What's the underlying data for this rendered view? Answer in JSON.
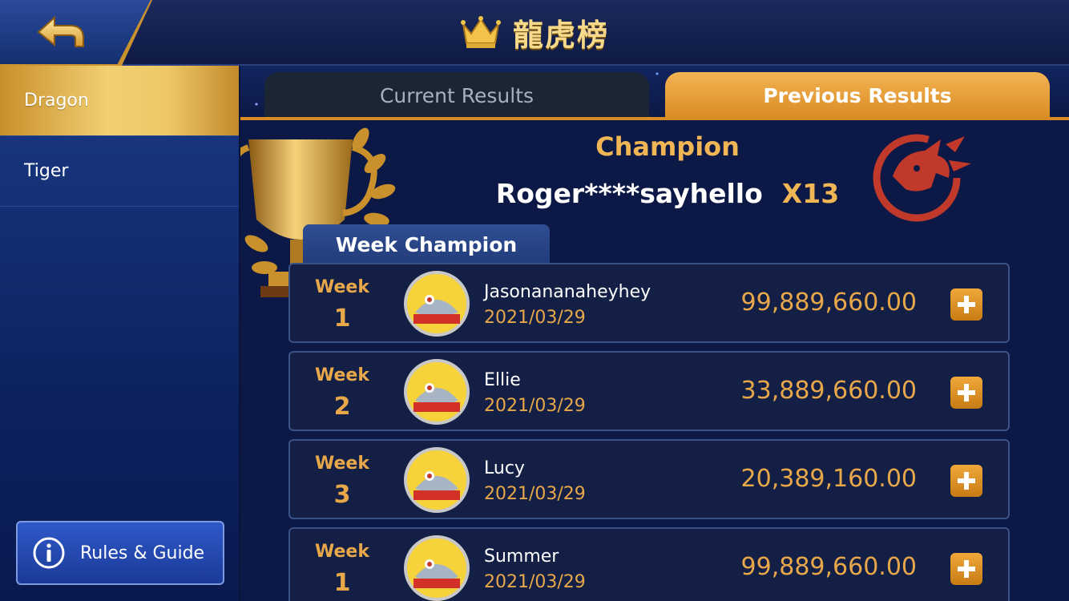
{
  "header": {
    "title": "龍虎榜",
    "back_icon": "back-arrow-icon",
    "crown_icon": "crown-icon"
  },
  "sidebar": {
    "items": [
      {
        "label": "Dragon",
        "active": true
      },
      {
        "label": "Tiger",
        "active": false
      }
    ],
    "rules_button": {
      "label": "Rules & Guide",
      "icon": "info-icon"
    }
  },
  "tabs": [
    {
      "label": "Current Results",
      "active": false
    },
    {
      "label": "Previous Results",
      "active": true
    }
  ],
  "champion": {
    "label": "Champion",
    "name": "Roger****sayhello",
    "multiplier": "X13"
  },
  "week_champion_label": "Week Champion",
  "rows": [
    {
      "week_word": "Week",
      "week_num": "1",
      "player": "Jasonananaheyhey",
      "date": "2021/03/29",
      "amount": "99,889,660.00"
    },
    {
      "week_word": "Week",
      "week_num": "2",
      "player": "Ellie",
      "date": "2021/03/29",
      "amount": "33,889,660.00"
    },
    {
      "week_word": "Week",
      "week_num": "3",
      "player": "Lucy",
      "date": "2021/03/29",
      "amount": "20,389,160.00"
    },
    {
      "week_word": "Week",
      "week_num": "1",
      "player": "Summer",
      "date": "2021/03/29",
      "amount": "99,889,660.00"
    }
  ],
  "colors": {
    "accent_gold": "#f0b554",
    "panel_bg": "#0c1845",
    "row_border": "#3b5289",
    "dragon_red": "#c0392b"
  }
}
